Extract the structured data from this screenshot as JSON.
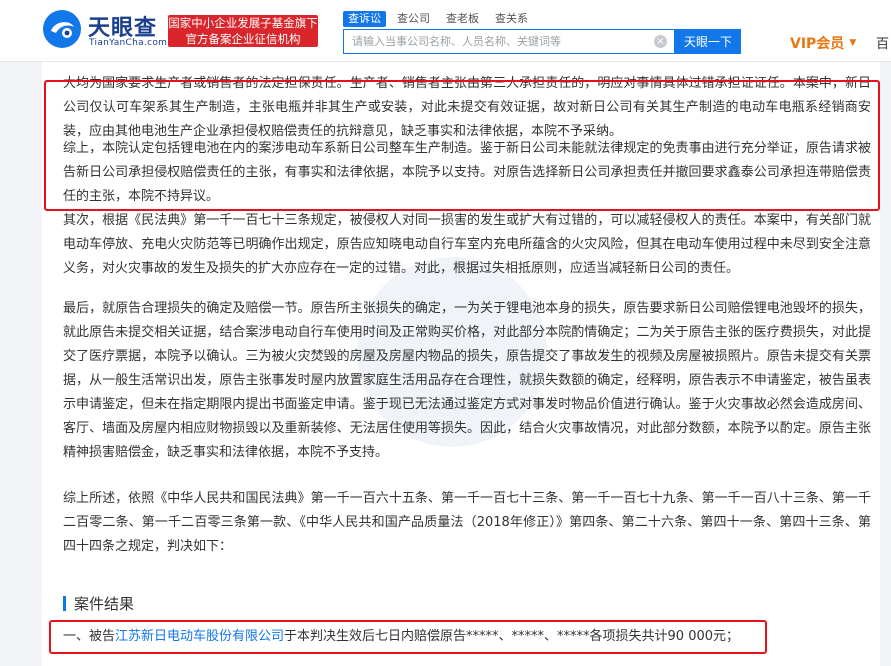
{
  "header": {
    "brand_cn": "天眼查",
    "brand_en": "TianYanCha.com",
    "slogan_line1": "国家中小企业发展子基金旗下",
    "slogan_line2": "官方备案企业征信机构",
    "tabs": [
      {
        "label": "查诉讼",
        "active": true
      },
      {
        "label": "查公司",
        "active": false
      },
      {
        "label": "查老板",
        "active": false
      },
      {
        "label": "查关系",
        "active": false
      }
    ],
    "search_placeholder": "请输入当事公司名称、人员名称、关键词等",
    "search_button": "天眼一下",
    "vip_label": "VIP会员",
    "more_label": "百"
  },
  "document": {
    "paragraphs": [
      "大均为国家要求生产者或销售者的法定担保责任。生产者、销售者主张由第三人承担责任的，明应对事情具体过错承担证证任。本案中，新日公司仅认可车架系其生产制造，主张电瓶并非其生产或安装，对此未提交有效证据，故对新日公司有关其生产制造的电动车电瓶系经销商安装，应由其他电池生产企业承担侵权赔偿责任的抗辩意见，缺乏事实和法律依据，本院不予采纳。",
      "综上，本院认定包括锂电池在内的案涉电动车系新日公司整车生产制造。鉴于新日公司未能就法律规定的免责事由进行充分举证，原告请求被告新日公司承担侵权赔偿责任的主张，有事实和法律依据，本院予以支持。对原告选择新日公司承担责任并撤回要求鑫泰公司承担连带赔偿责任的主张，本院不持异议。",
      "其次，根据《民法典》第一千一百七十三条规定，被侵权人对同一损害的发生或扩大有过错的，可以减轻侵权人的责任。本案中，有关部门就电动车停放、充电火灾防范等已明确作出规定，原告应知晓电动自行车室内充电所蕴含的火灾风险，但其在电动车使用过程中未尽到安全注意义务，对火灾事故的发生及损失的扩大亦应存在一定的过错。对此，根据过失相抵原则，应适当减轻新日公司的责任。",
      "最后，就原告合理损失的确定及赔偿一节。原告所主张损失的确定，一为关于锂电池本身的损失，原告要求新日公司赔偿锂电池毁坏的损失，就此原告未提交相关证据，结合案涉电动自行车使用时间及正常购买价格，对此部分本院酌情确定；二为关于原告主张的医疗费损失，对此提交了医疗票据，本院予以确认。三为被火灾焚毁的房屋及房屋内物品的损失，原告提交了事故发生的视频及房屋被损照片。原告未提交有关票据，从一般生活常识出发，原告主张事发时屋内放置家庭生活用品存在合理性，就损失数额的确定，经释明，原告表示不申请鉴定，被告虽表示申请鉴定，但未在指定期限内提出书面鉴定申请。鉴于现已无法通过鉴定方式对事发时物品价值进行确认。鉴于火灾事故必然会造成房间、客厅、墙面及房屋内相应财物损毁以及重新装修、无法居住使用等损失。因此，结合火灾事故情况，对此部分数额，本院予以酌定。原告主张精神损害赔偿金，缺乏事实和法律依据，本院不予支持。",
      "综上所述，依照《中华人民共和国民法典》第一千一百六十五条、第一千一百七十三条、第一千一百七十九条、第一千一百八十三条、第一千二百零二条、第一千二百零三条第一款、《中华人民共和国产品质量法（2018年修正）》第四条、第二十六条、第四十一条、第四十三条、第四十四条之规定，判决如下："
    ],
    "result_section_title": "案件结果",
    "result_prefix": "一、被告",
    "result_company": "江苏新日电动车股份有限公司",
    "result_suffix": "于本判决生效后七日内赔偿原告*****、*****、*****各项损失共计90 000元；"
  }
}
